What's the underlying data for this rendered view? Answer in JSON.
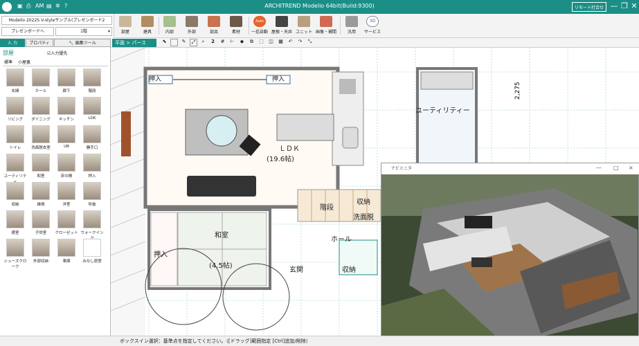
{
  "app": {
    "title": "ARCHITREND Modelio 64bit(Build:9300)",
    "remote_label": "リモート打合せ",
    "quick_access": [
      "save-icon",
      "print-icon",
      "am-icon",
      "settings-icon",
      "help-icon"
    ],
    "qa_am": "AM",
    "help": "?"
  },
  "ribbon": {
    "project": "Modelio 2022S V-styleサンプル(プレゼンボード2",
    "board": "プレゼンボードへ",
    "floor": "1階",
    "buttons": [
      "部屋",
      "建具",
      "内部",
      "外部",
      "部品",
      "素材",
      "一括自動",
      "屋根・天井",
      "ユニット",
      "画像・補間",
      "汎用",
      "サービス"
    ],
    "auto_label": "Auto",
    "threed_label": "3D"
  },
  "panel": {
    "tabs": [
      "入 力",
      "プロパティ",
      "編集ツール"
    ],
    "category": "部屋",
    "checkbox": "入力優先",
    "subtabs": [
      "標準",
      "小屋裏"
    ],
    "items": [
      "玄関",
      "ホール",
      "廊下",
      "階段",
      "リビング",
      "ダイニング",
      "キッチン",
      "LDK",
      "トイレ",
      "洗面脱衣室",
      "UB",
      "勝手口",
      "ユーティリティ",
      "和室",
      "床の間",
      "押入",
      "収納",
      "縁側",
      "洋室",
      "吹抜",
      "寝室",
      "子供室",
      "クローゼット",
      "ウォークインク",
      "シューズクローク",
      "外部収納",
      "車庫",
      "みなし居室"
    ]
  },
  "toolbar2": {
    "mode": "平面 > パース",
    "tools": [
      "pointer",
      "box-select",
      "2",
      "grid"
    ],
    "num": "2"
  },
  "plan": {
    "labels": {
      "ldk": "ＬＤＫ",
      "ldk_area": "(19.6帖)",
      "utility": "ユーティリティー",
      "washoku": "和室",
      "washoku_area": "(4.5帖)",
      "oshiire": "押入",
      "oshiire2": "押入",
      "oshiire3": "押入",
      "genkan": "玄関",
      "hall": "ホール",
      "shuno": "収納",
      "kaidan": "階段",
      "senmen": "洗面脱",
      "shuno2": "収納",
      "dim": "2,275"
    }
  },
  "pview": {
    "title": "ナビミニタ",
    "min": "—",
    "max": "□",
    "close": "×"
  },
  "status": "ボックスイン選択：基準点を指定してください。（[ドラッグ]範囲指定 [Ctrl]追加/削除）",
  "colors": {
    "accent": "#1b8f86"
  }
}
